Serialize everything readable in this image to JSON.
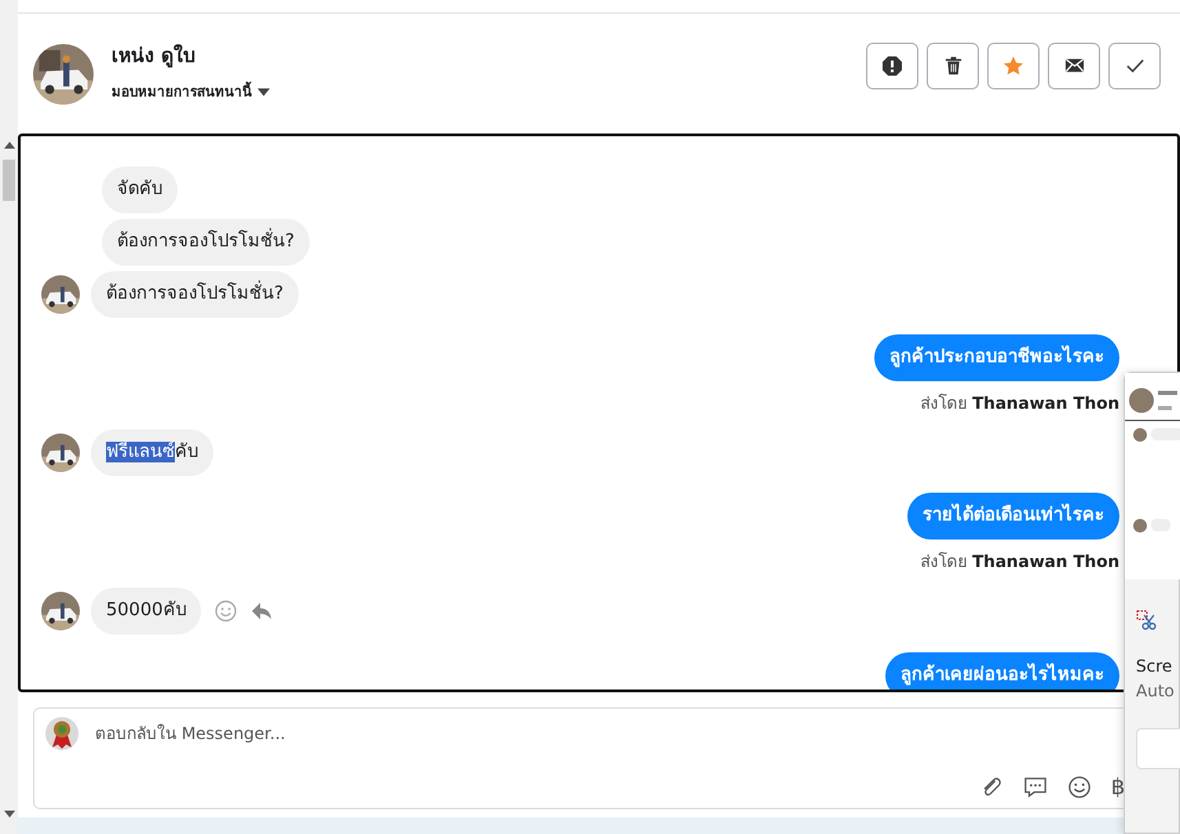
{
  "header": {
    "name": "เหน่ง ดูใบ",
    "assign_label": "มอบหมายการสนทนานี้",
    "actions": [
      {
        "kind": "alert",
        "on": false
      },
      {
        "kind": "trash",
        "on": false
      },
      {
        "kind": "star",
        "on": true
      },
      {
        "kind": "mail",
        "on": false
      },
      {
        "kind": "check",
        "on": false
      }
    ]
  },
  "messages": [
    {
      "kind": "received",
      "avatar": false,
      "parts": [
        {
          "text": "จัดคับ",
          "highlighted": false
        }
      ]
    },
    {
      "kind": "received",
      "avatar": false,
      "parts": [
        {
          "text": "ต้องการจองโปรโมชั่น?",
          "highlighted": false
        }
      ]
    },
    {
      "kind": "received",
      "avatar": true,
      "parts": [
        {
          "text": "ต้องการจองโปรโมชั่น?",
          "highlighted": false
        }
      ]
    },
    {
      "kind": "sent",
      "parts": [
        {
          "text": "ลูกค้าประกอบอาชีพอะไรคะ",
          "highlighted": false
        }
      ],
      "sender_prefix": "ส่งโดย",
      "sender": "Thanawan Thon"
    },
    {
      "kind": "received",
      "avatar": true,
      "parts": [
        {
          "text": "ฟรีแลนซ์",
          "highlighted": true
        },
        {
          "text": "คับ",
          "highlighted": false
        }
      ]
    },
    {
      "kind": "sent",
      "parts": [
        {
          "text": "รายได้ต่อเดือนเท่าไรคะ",
          "highlighted": false
        }
      ],
      "sender_prefix": "ส่งโดย",
      "sender": "Thanawan Thon"
    },
    {
      "kind": "received",
      "avatar": true,
      "reactions": true,
      "parts": [
        {
          "text": "50000คับ",
          "highlighted": false
        }
      ]
    },
    {
      "kind": "sent",
      "parts": [
        {
          "text": "ลูกค้าเคยผ่อนอะไรไหมคะ",
          "highlighted": false
        }
      ]
    }
  ],
  "composer": {
    "placeholder": "ตอบกลับใน Messenger...",
    "currency_symbol": "฿"
  },
  "notification": {
    "title": "Scre",
    "subtitle": "Auto"
  }
}
